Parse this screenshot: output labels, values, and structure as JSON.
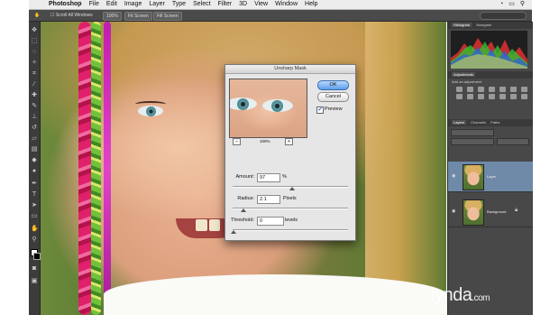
{
  "menubar": {
    "app": "Photoshop",
    "menus": [
      "File",
      "Edit",
      "Image",
      "Layer",
      "Type",
      "Select",
      "Filter",
      "3D",
      "View",
      "Window",
      "Help"
    ]
  },
  "options_bar": {
    "scroll_all_windows": "Scroll All Windows",
    "zoom_value": "100%",
    "fit_screen": "Fit Screen",
    "fill_screen": "Fill Screen"
  },
  "panels": {
    "histogram_tab": "Histogram",
    "navigator_tab": "Navigator",
    "adjustments_tab": "Adjustments",
    "add_adjustment": "Add an adjustment",
    "layers_tab": "Layers",
    "channels_tab": "Channels",
    "paths_tab": "Paths",
    "layers": [
      {
        "name": "Layer"
      },
      {
        "name": "Background"
      }
    ]
  },
  "dialog": {
    "title": "Unsharp Mask",
    "ok": "OK",
    "cancel": "Cancel",
    "preview_label": "Preview",
    "preview_checked": true,
    "zoom": "100%",
    "amount_label": "Amount:",
    "amount_value": "97",
    "amount_unit": "%",
    "radius_label": "Radius:",
    "radius_value": "2.1",
    "radius_unit": "Pixels",
    "threshold_label": "Threshold:",
    "threshold_value": "0",
    "threshold_unit": "levels"
  },
  "watermark": {
    "brand": "lynda",
    "suffix": ".com"
  },
  "colors": {
    "panel_bg": "#484848",
    "ok_button": "#5d9ee8",
    "dialog_bg": "#e6e6e6"
  }
}
